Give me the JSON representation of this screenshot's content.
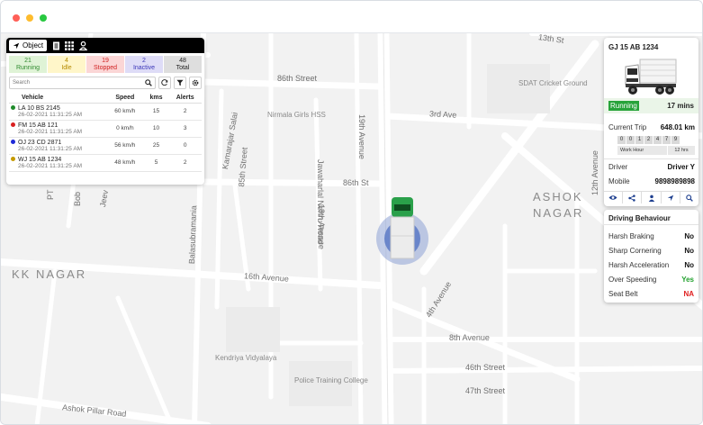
{
  "map": {
    "areas": [
      "KK NAGAR",
      "ASHOK",
      "NAGAR"
    ],
    "streets": [
      "13th St",
      "86th Street",
      "3rd Ave",
      "86th St",
      "16th Avenue",
      "Jawaharlal Nehru Road",
      "19th Avenue",
      "18th Avenue",
      "85th Street",
      "Kamarajar Salai",
      "Balasubramania",
      "4th Avenue",
      "8th Avenue",
      "46th Street",
      "47th Street",
      "Ashok Pillar Road",
      "Bob",
      "Jeev",
      "PT",
      "12th Avenue"
    ],
    "pois": [
      "SDAT Cricket Ground",
      "Nirmala Girls HSS",
      "Kendriya Vidyalaya",
      "Police Training College"
    ]
  },
  "object_panel": {
    "tab_label": "Object",
    "status": [
      {
        "count": "21",
        "label": "Running",
        "bg": "#dff3d6",
        "color": "#2f8a2f"
      },
      {
        "count": "4",
        "label": "Idle",
        "bg": "#fff6c9",
        "color": "#b58a00"
      },
      {
        "count": "19",
        "label": "Stopped",
        "bg": "#fbd6d6",
        "color": "#d02020"
      },
      {
        "count": "2",
        "label": "Inactive",
        "bg": "#dedcf7",
        "color": "#3a35b8"
      },
      {
        "count": "48",
        "label": "Total",
        "bg": "#dedede",
        "color": "#222222"
      }
    ],
    "search_placeholder": "Search",
    "columns": [
      "Vehicle",
      "Speed",
      "kms",
      "Alerts"
    ],
    "rows": [
      {
        "name": "LA 10 BS 2145",
        "time": "26-02-2021 11:31:25 AM",
        "speed": "60 km/h",
        "kms": "15",
        "alerts": "2",
        "dot": "#1f8a2a"
      },
      {
        "name": "FM 15 AB 121",
        "time": "26-02-2021 11:31:25 AM",
        "speed": "0 km/h",
        "kms": "10",
        "alerts": "3",
        "dot": "#d81f1f"
      },
      {
        "name": "OJ 23 CD 2871",
        "time": "26-02-2021 11:31:25 AM",
        "speed": "56 km/h",
        "kms": "25",
        "alerts": "0",
        "dot": "#1f2ad8"
      },
      {
        "name": "WJ 15 AB 1234",
        "time": "26-02-2021 11:31:25 AM",
        "speed": "48 km/h",
        "kms": "5",
        "alerts": "2",
        "dot": "#c59a00"
      }
    ]
  },
  "detail": {
    "plate": "GJ 15 AB 1234",
    "status": "Running",
    "duration": "17 mins",
    "trip_label": "Current Trip",
    "trip_value": "648.01 km",
    "odometer": [
      "0",
      "0",
      "1",
      "2",
      "4",
      "7",
      "9"
    ],
    "work_hour_label": "Work Hour",
    "work_hour_value": "12 hrs",
    "driver_label": "Driver",
    "driver_value": "Driver Y",
    "mobile_label": "Mobile",
    "mobile_value": "9898989898"
  },
  "behaviour": {
    "title": "Driving Behaviour",
    "rows": [
      {
        "label": "Harsh Braking",
        "value": "No"
      },
      {
        "label": "Sharp Cornering",
        "value": "No"
      },
      {
        "label": "Harsh Acceleration",
        "value": "No"
      },
      {
        "label": "Over Speeding",
        "value": "Yes"
      },
      {
        "label": "Seat Belt",
        "value": "NA"
      }
    ]
  }
}
